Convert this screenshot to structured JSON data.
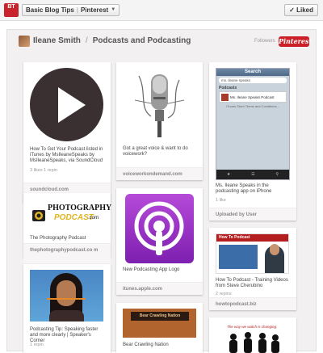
{
  "topbar": {
    "logo_label": "BT",
    "breadcrumb_board": "Basic Blog Tips",
    "breadcrumb_site": "Pinterest",
    "liked_label": "✓ Liked"
  },
  "header": {
    "user": "Ileane Smith",
    "board": "Podcasts and Podcasting",
    "followers_label": "Followers",
    "pinterest_label": "Pinterest"
  },
  "pins": [
    {
      "desc": "How To Get Your Podcast listed in iTunes by MsIleaneSpeaks by MsIleaneSpeaks, via SoundCloud",
      "stats": "3 likes    1 repin",
      "source": "soundcloud.com"
    },
    {
      "desc": "Got a great voice & want to do voicework?",
      "stats": "",
      "source": "voiceworkondemand.com"
    },
    {
      "desc": "Ms. Ileane Speaks in the podcasting app on iPhone",
      "stats": "1 like",
      "source": "Uploaded by User"
    },
    {
      "desc": "The Photography Podcast",
      "stats": "",
      "source": "thephotographypodcast.co m"
    },
    {
      "desc": "New Podcasting App Logo",
      "stats": "",
      "source": "itunes.apple.com"
    },
    {
      "desc": "How To Podcast - Training Videos from Steve Cherubino",
      "stats": "2 repins",
      "source": "howtopodcast.biz"
    },
    {
      "desc": "Podcasting Tip: Speaking faster and more clearly | Speaker's Corner",
      "stats": "1 repin",
      "source": ""
    },
    {
      "desc": "Bear Crawling Nation",
      "stats": "",
      "source": ""
    },
    {
      "desc": "",
      "stats": "",
      "source": ""
    }
  ],
  "phone": {
    "title": "Search",
    "search_text": "ms. ileane speaks",
    "cancel": "Cancel",
    "section": "Podcasts",
    "row_label": "Ms. Ileane Speaks Podcast",
    "footer": "iTunes Store Terms and Conditions..."
  },
  "images": {
    "photo_logo_line1": "PHOTOGRAPHY",
    "photo_logo_line2": "PODCAST",
    "photo_logo_com": ".com",
    "ht_banner": "How To Podcast",
    "bear_label": "Bear Crawling Nation",
    "silh_caption": "The way we watch is changing."
  },
  "colors": {
    "pinterest_red": "#cb2027",
    "logo_red": "#c8232c",
    "panel_bg": "#f2f0f0"
  }
}
